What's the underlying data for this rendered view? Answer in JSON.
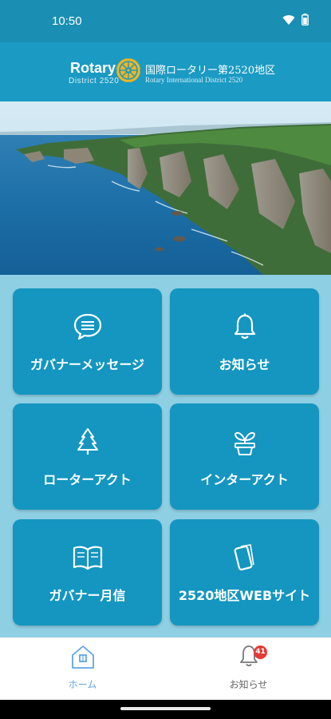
{
  "status_bar": {
    "time": "10:50"
  },
  "header": {
    "logo_rotary": "Rotary",
    "logo_district": "District 2520",
    "logo_jp": "国際ロータリー第2520地区",
    "logo_en": "Rotary International District 2520"
  },
  "hero": {
    "image": "coastal-cliffs-photo"
  },
  "menu": [
    {
      "label": "ガバナーメッセージ",
      "icon": "chat-bubble-icon"
    },
    {
      "label": "お知らせ",
      "icon": "bell-icon"
    },
    {
      "label": "ローターアクト",
      "icon": "tree-icon"
    },
    {
      "label": "インターアクト",
      "icon": "sprout-icon"
    },
    {
      "label": "ガバナー月信",
      "icon": "open-book-icon"
    },
    {
      "label": "2520地区WEBサイト",
      "icon": "mobile-phone-icon"
    }
  ],
  "bottom_nav": {
    "home_label": "ホーム",
    "notices_label": "お知らせ",
    "notices_badge": "41"
  },
  "colors": {
    "card": "#1496c1",
    "header": "#1b9ac3",
    "status_bar": "#1a8fb3",
    "background": "#8fcfe3",
    "nav_active": "#5fa6e6",
    "badge": "#e53935"
  }
}
